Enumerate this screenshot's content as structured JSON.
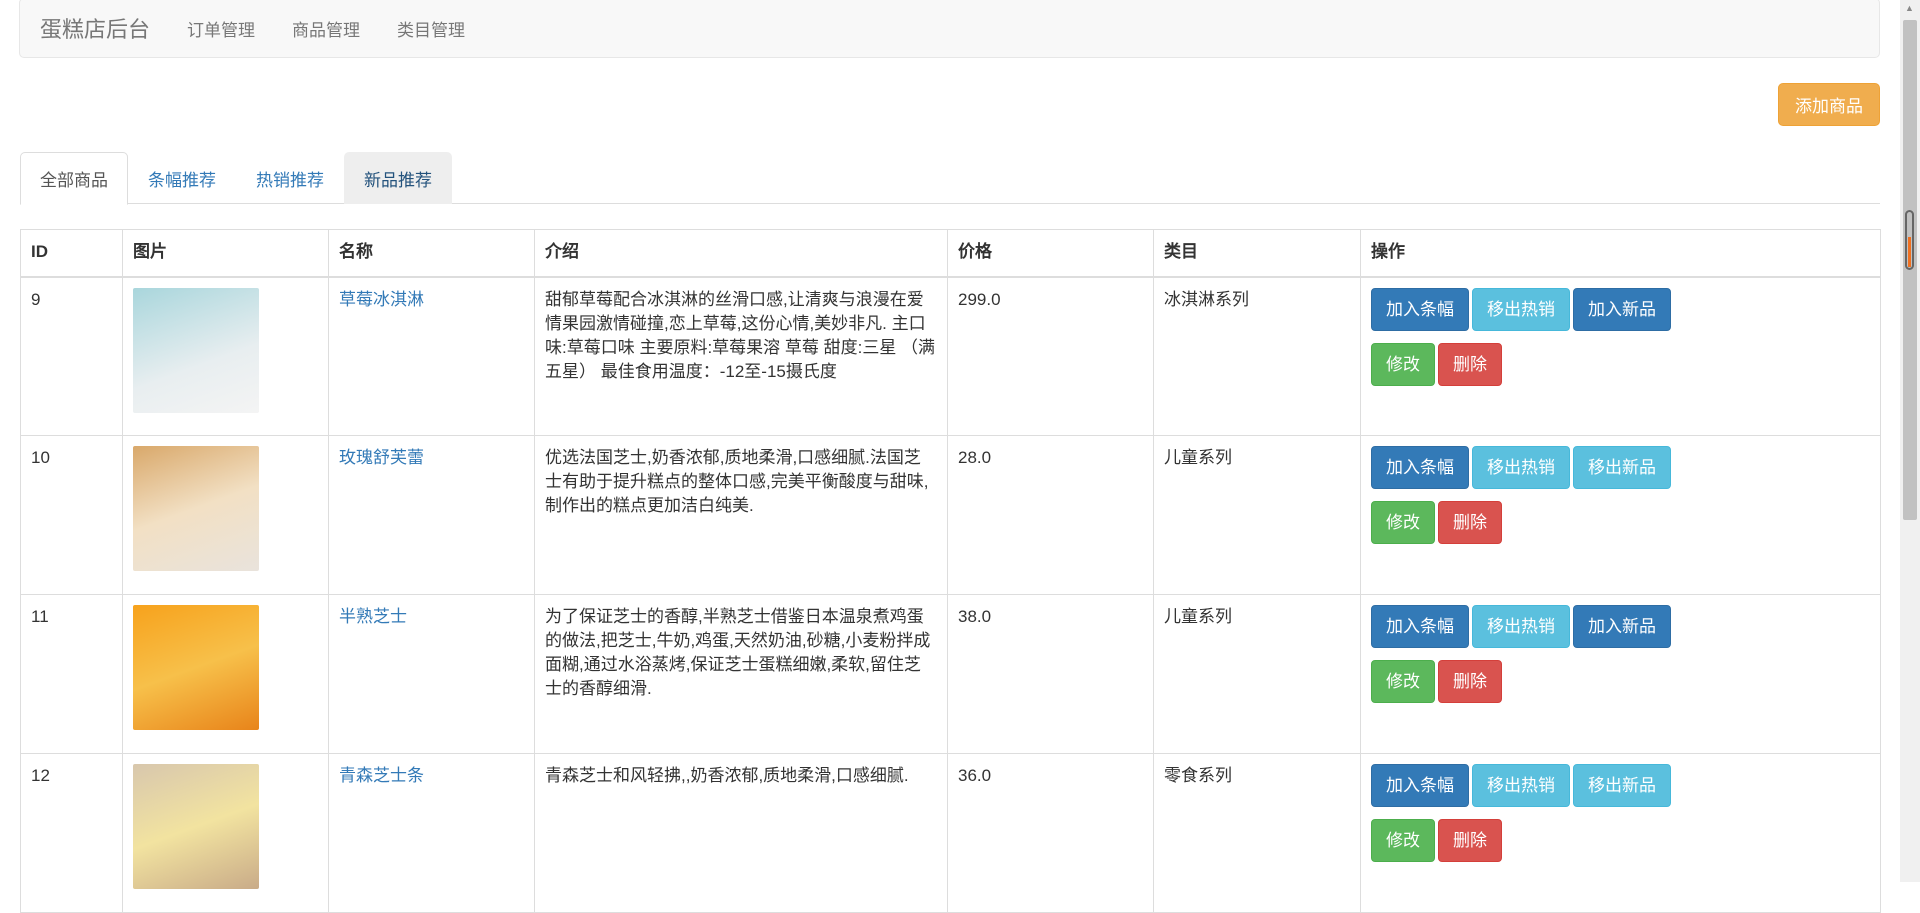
{
  "navbar": {
    "brand": "蛋糕店后台",
    "links": [
      "订单管理",
      "商品管理",
      "类目管理"
    ]
  },
  "add_button": "添加商品",
  "tabs": [
    "全部商品",
    "条幅推荐",
    "热销推荐",
    "新品推荐"
  ],
  "table": {
    "headers": [
      "ID",
      "图片",
      "名称",
      "介绍",
      "价格",
      "类目",
      "操作"
    ],
    "rows": [
      {
        "id": "9",
        "name": "草莓冰淇淋",
        "desc": "甜郁草莓配合冰淇淋的丝滑口感,让清爽与浪漫在爱情果园激情碰撞,恋上草莓,这份心情,美妙非凡. 主口味:草莓口味 主要原料:草莓果溶 草莓 甜度:三星 （满五星） 最佳食用温度：-12至-15摄氏度",
        "price": "299.0",
        "category": "冰淇淋系列",
        "actions": [
          "加入条幅",
          "移出热销",
          "加入新品",
          "修改",
          "删除"
        ]
      },
      {
        "id": "10",
        "name": "玫瑰舒芙蕾",
        "desc": "优选法国芝士,奶香浓郁,质地柔滑,口感细腻.法国芝士有助于提升糕点的整体口感,完美平衡酸度与甜味,制作出的糕点更加洁白纯美.",
        "price": "28.0",
        "category": "儿童系列",
        "actions": [
          "加入条幅",
          "移出热销",
          "移出新品",
          "修改",
          "删除"
        ]
      },
      {
        "id": "11",
        "name": "半熟芝士",
        "desc": "为了保证芝士的香醇,半熟芝士借鉴日本温泉煮鸡蛋的做法,把芝士,牛奶,鸡蛋,天然奶油,砂糖,小麦粉拌成面糊,通过水浴蒸烤,保证芝士蛋糕细嫩,柔软,留住芝士的香醇细滑.",
        "price": "38.0",
        "category": "儿童系列",
        "actions": [
          "加入条幅",
          "移出热销",
          "加入新品",
          "修改",
          "删除"
        ]
      },
      {
        "id": "12",
        "name": "青森芝士条",
        "desc": "青森芝士和风轻拂,,奶香浓郁,质地柔滑,口感细腻.",
        "price": "36.0",
        "category": "零食系列",
        "actions": [
          "加入条幅",
          "移出热销",
          "移出新品",
          "修改",
          "删除"
        ]
      }
    ]
  }
}
